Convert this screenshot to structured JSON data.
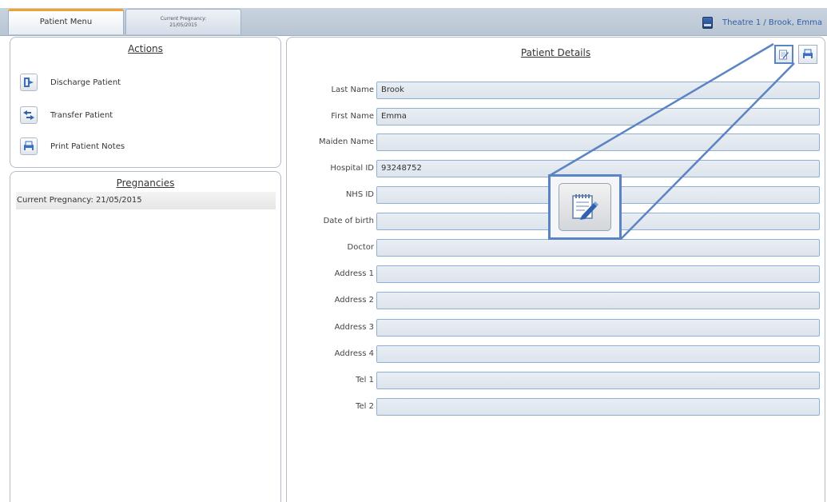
{
  "tabs": {
    "patient_menu": "Patient Menu",
    "current_pregnancy_line1": "Current Pregnancy:",
    "current_pregnancy_line2": "21/05/2015"
  },
  "status": {
    "text": "Theatre 1 / Brook, Emma"
  },
  "actions": {
    "title": "Actions",
    "items": [
      {
        "label": "Discharge Patient",
        "icon": "discharge-icon"
      },
      {
        "label": "Transfer Patient",
        "icon": "transfer-icon"
      },
      {
        "label": "Print Patient Notes",
        "icon": "print-icon"
      }
    ]
  },
  "pregnancies": {
    "title": "Pregnancies",
    "items": [
      "Current Pregnancy: 21/05/2015"
    ]
  },
  "details": {
    "title": "Patient Details",
    "fields": [
      {
        "label": "Last Name",
        "value": "Brook"
      },
      {
        "label": "First Name",
        "value": "Emma"
      },
      {
        "label": "Maiden Name",
        "value": ""
      },
      {
        "label": "Hospital ID",
        "value": "93248752"
      },
      {
        "label": "NHS ID",
        "value": ""
      },
      {
        "label": "Date of birth",
        "value": ""
      },
      {
        "label": "Doctor",
        "value": ""
      },
      {
        "label": "Address 1",
        "value": ""
      },
      {
        "label": "Address 2",
        "value": ""
      },
      {
        "label": "Address 3",
        "value": ""
      },
      {
        "label": "Address 4",
        "value": ""
      },
      {
        "label": "Tel 1",
        "value": ""
      },
      {
        "label": "Tel 2",
        "value": ""
      }
    ]
  },
  "colors": {
    "accent": "#5b84c4",
    "tab_highlight": "#f0a030",
    "status_text": "#2f5fa8"
  }
}
